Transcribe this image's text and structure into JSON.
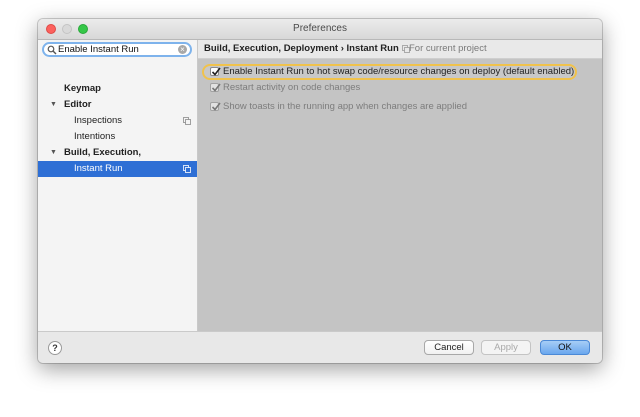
{
  "window": {
    "title": "Preferences"
  },
  "search": {
    "value": "Enable Instant Run",
    "clear_icon": "×"
  },
  "sidebar": {
    "items": [
      {
        "label": "Keymap"
      },
      {
        "label": "Editor"
      },
      {
        "label": "Inspections"
      },
      {
        "label": "Intentions"
      },
      {
        "label": "Build, Execution, Deployment"
      },
      {
        "label": "Instant Run"
      }
    ]
  },
  "breadcrumb": {
    "title": "Build, Execution, Deployment › Instant Run",
    "scope": "For current project"
  },
  "options": [
    {
      "label": "Enable Instant Run to hot swap code/resource changes on deploy (default enabled)",
      "checked": true
    },
    {
      "label": "Restart activity on code changes",
      "checked": true
    },
    {
      "label": "Show toasts in the running app when changes are applied",
      "checked": true
    }
  ],
  "footer": {
    "help_label": "?",
    "cancel_label": "Cancel",
    "apply_label": "Apply",
    "ok_label": "OK"
  },
  "colors": {
    "selection": "#2e6fd5",
    "highlight_ring": "#f0c24c",
    "ok_button": "#6aa7ee"
  },
  "icons": {
    "search": "search-icon",
    "clear": "clear-icon",
    "copy": "copy-icon",
    "scope": "project-scope-icon",
    "checkbox": "checkmark-icon"
  }
}
